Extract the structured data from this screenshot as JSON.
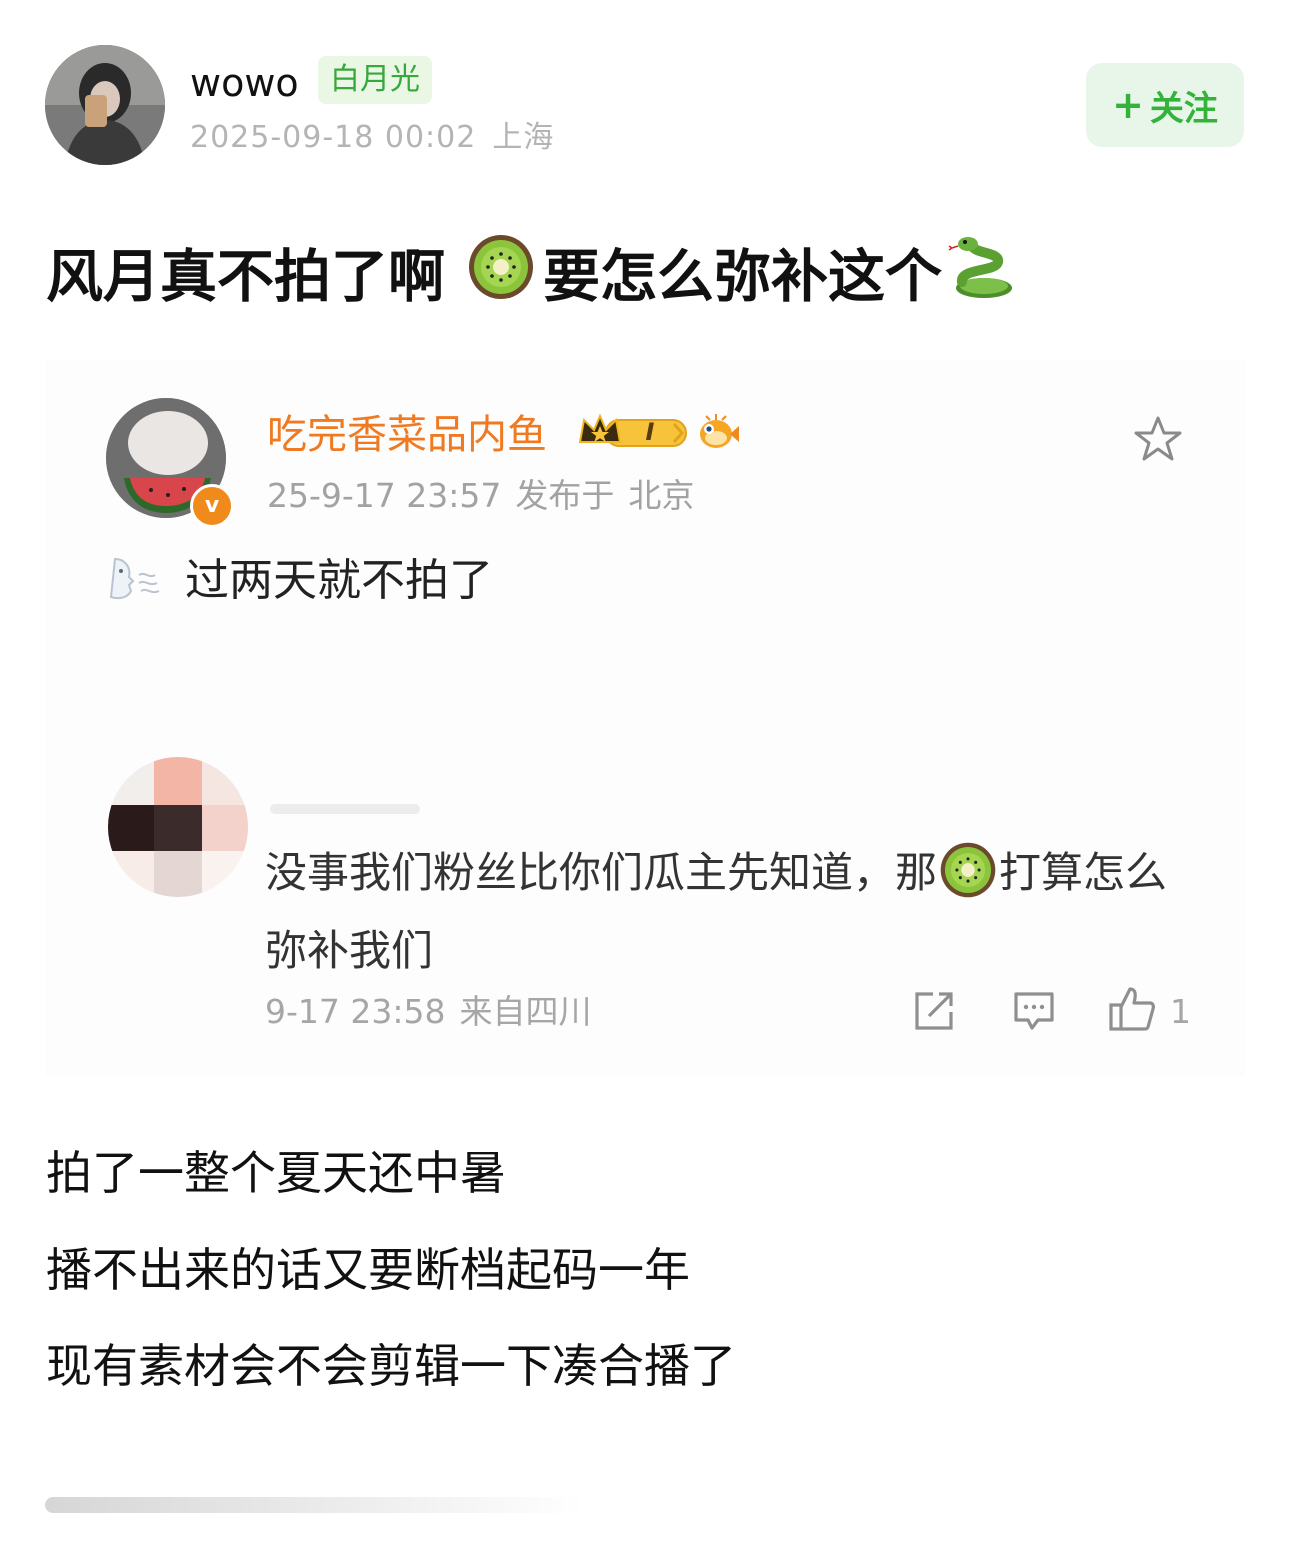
{
  "post": {
    "username": "wowo",
    "tag": "白月光",
    "time": "2025-09-18 00:02",
    "location": "上海",
    "follow_label": "关注",
    "follow_plus": "+",
    "title_part1": "风月真不拍了啊",
    "title_part2": "要怎么弥补这个",
    "lines": [
      "拍了一整个夏天还中暑",
      "播不出来的话又要断档起码一年",
      "现有素材会不会剪辑一下凑合播了"
    ]
  },
  "quoted": {
    "name": "吃完香菜品内鱼",
    "rank": "I",
    "verified_mark": "v",
    "time": "25-9-17 23:57",
    "published_prefix": "发布于",
    "location": "北京",
    "text": "过两天就不拍了"
  },
  "reply": {
    "text_before": "没事我们粉丝比你们瓜主先知道，那",
    "text_after": "打算怎么弥补我们",
    "time": "9-17 23:58",
    "location": "来自四川",
    "like_count": "1"
  },
  "icons": {
    "kiwi": "kiwi-emoji",
    "snake": "snake-emoji",
    "blow": "blow-emoji",
    "fish": "pufferfish-icon",
    "crown": "crown-icon",
    "star": "star-icon",
    "share": "share-icon",
    "comment": "comment-icon",
    "like": "thumbs-up-icon"
  },
  "colors": {
    "follow_green": "#33b23c",
    "tag_green": "#37a83b",
    "name_orange": "#f07a22",
    "meta_gray": "#a6a6a6"
  }
}
